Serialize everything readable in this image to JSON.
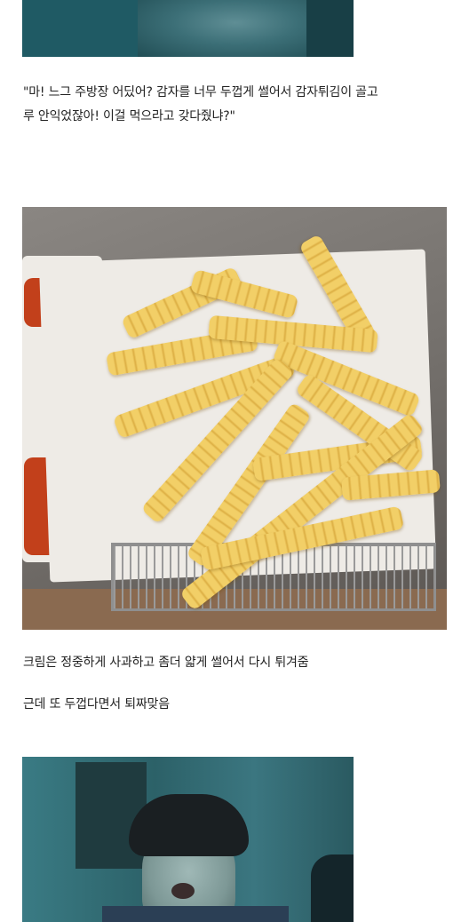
{
  "post": {
    "quote": "\"마! 느그 주방장 어딨어? 감자를 너무 두껍게 썰어서 감자튀김이 골고",
    "quote_line2": "루 안익었잖아! 이걸 먹으라고 갖다줬냐?\"",
    "line3": "크림은 정중하게 사과하고 좀더 얇게 썰어서 다시 튀겨줌",
    "line4": "근데 또 두껍다면서 퇴짜맞음"
  }
}
